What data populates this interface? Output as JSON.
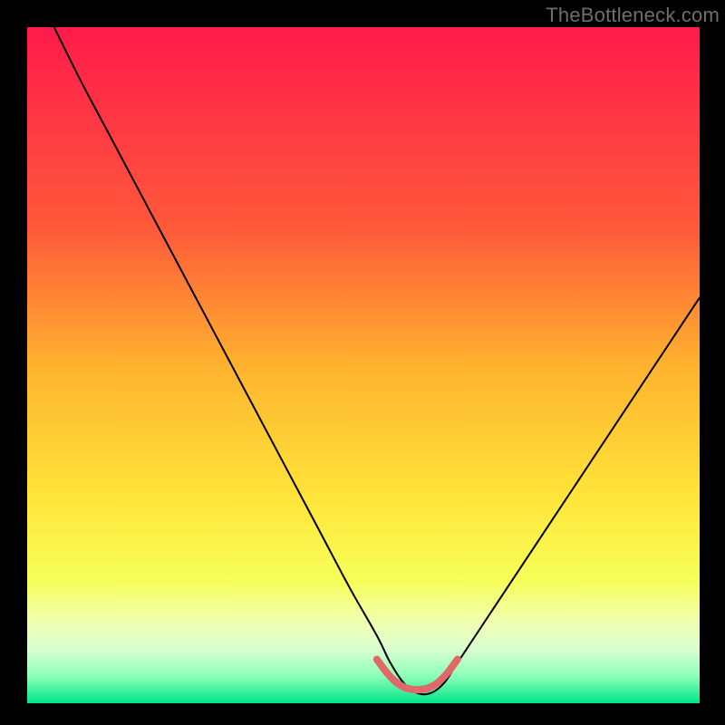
{
  "watermark": "TheBottleneck.com",
  "chart_data": {
    "type": "line",
    "title": "",
    "xlabel": "",
    "ylabel": "",
    "xlim": [
      0,
      100
    ],
    "ylim": [
      0,
      100
    ],
    "grid": false,
    "legend": false,
    "annotations": [],
    "background_gradient": {
      "stops": [
        {
          "offset": 0.0,
          "color": "#ff1a4b"
        },
        {
          "offset": 0.3,
          "color": "#ff5a3a"
        },
        {
          "offset": 0.5,
          "color": "#ffb22e"
        },
        {
          "offset": 0.7,
          "color": "#ffe63a"
        },
        {
          "offset": 0.82,
          "color": "#f6ff5a"
        },
        {
          "offset": 0.88,
          "color": "#f0ffb0"
        },
        {
          "offset": 0.92,
          "color": "#d9ffd0"
        },
        {
          "offset": 0.96,
          "color": "#8cffb8"
        },
        {
          "offset": 1.0,
          "color": "#00e38a"
        }
      ]
    },
    "series": [
      {
        "name": "bottleneck-curve",
        "color": "#000000",
        "width": 2,
        "x": [
          4,
          8,
          12,
          16,
          20,
          24,
          28,
          32,
          36,
          40,
          44,
          48,
          52,
          54,
          56,
          58,
          60,
          62,
          64,
          68,
          72,
          76,
          80,
          84,
          88,
          92,
          96,
          100
        ],
        "values": [
          100,
          92,
          84.5,
          77,
          69.5,
          62,
          54.5,
          47,
          39.5,
          32,
          24.5,
          17,
          10,
          6,
          3,
          1.5,
          1.5,
          3,
          6,
          12,
          18,
          24,
          30,
          36,
          42,
          48,
          54,
          60
        ]
      },
      {
        "name": "sweet-spot-marker",
        "color": "#e06868",
        "width": 8,
        "x": [
          52,
          53.5,
          55,
          56.5,
          58,
          59.5,
          61,
          62.5,
          64
        ],
        "values": [
          6.5,
          4.5,
          3,
          2.2,
          2,
          2.2,
          3,
          4.5,
          6.5
        ]
      }
    ]
  }
}
